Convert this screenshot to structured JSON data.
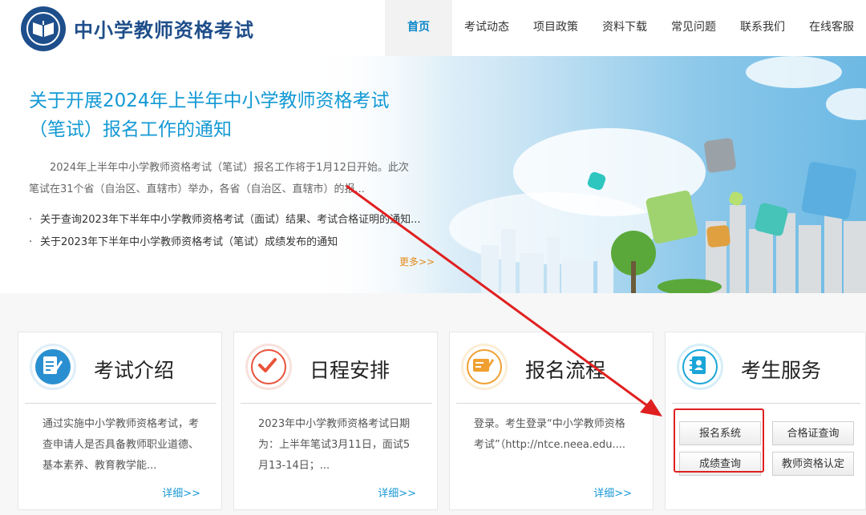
{
  "header": {
    "site_title": "中小学教师资格考试",
    "nav": [
      {
        "label": "首页",
        "active": true
      },
      {
        "label": "考试动态"
      },
      {
        "label": "项目政策"
      },
      {
        "label": "资料下载"
      },
      {
        "label": "常见问题"
      },
      {
        "label": "联系我们"
      },
      {
        "label": "在线客服"
      }
    ]
  },
  "banner": {
    "title": "关于开展2024年上半年中小学教师资格考试（笔试）报名工作的通知",
    "summary": "2024年上半年中小学教师资格考试（笔试）报名工作将于1月12日开始。此次笔试在31个省（自治区、直辖市）举办，各省（自治区、直辖市）的报...",
    "bullet": "·",
    "news": [
      "关于查询2023年下半年中小学教师资格考试（面试）结果、考试合格证明的通知...",
      "关于2023年下半年中小学教师资格考试（笔试）成绩发布的通知"
    ],
    "more": "更多>>"
  },
  "cards": {
    "intro": {
      "title": "考试介绍",
      "text": "通过实施中小学教师资格考试，考查申请人是否具备教师职业道德、基本素养、教育教学能...",
      "detail": "详细>>",
      "color": "#2a8fd0"
    },
    "schedule": {
      "title": "日程安排",
      "text": "2023年中小学教师资格考试日期为：上半年笔试3月11日，面试5月13-14日；...",
      "detail": "详细>>",
      "color": "#e8523a"
    },
    "process": {
      "title": "报名流程",
      "text": "登录。考生登录“中小学教师资格考试”（http://ntce.neea.edu....",
      "detail": "详细>>",
      "color": "#f0a030"
    },
    "service": {
      "title": "考生服务",
      "color": "#1aa5d8",
      "buttons": {
        "register": "报名系统",
        "certificate": "合格证查询",
        "score": "成绩查询",
        "qualification": "教师资格认定"
      }
    }
  },
  "colors": {
    "brand": "#1f4e8a",
    "nav_active": "#0c86c9",
    "title_blue": "#1399d4",
    "highlight_red": "#e02020"
  }
}
